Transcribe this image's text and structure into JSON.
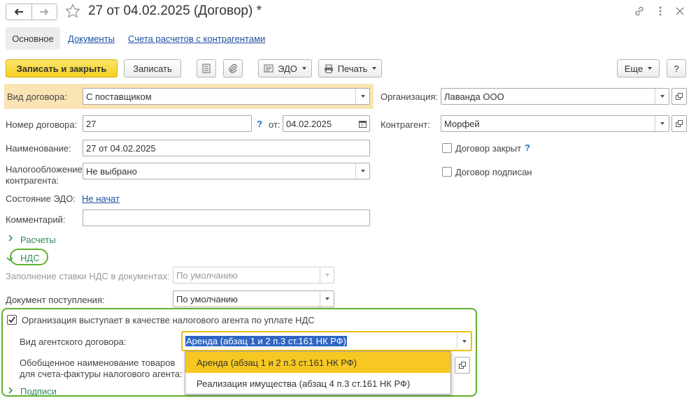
{
  "window": {
    "title": "27 от 04.02.2025 (Договор) *"
  },
  "tabs": [
    {
      "label": "Основное",
      "active": true
    },
    {
      "label": "Документы"
    },
    {
      "label": "Счета расчетов с контрагентами"
    }
  ],
  "toolbar": {
    "save_close": "Записать и закрыть",
    "save": "Записать",
    "edo": "ЭДО",
    "print": "Печать",
    "more": "Еще",
    "help": "?"
  },
  "form": {
    "vid": {
      "label": "Вид договора:",
      "value": "С поставщиком"
    },
    "nomer": {
      "label": "Номер договора:",
      "value": "27",
      "help": "?",
      "date_label": "от:",
      "date": "04.02.2025"
    },
    "naim": {
      "label": "Наименование:",
      "value": "27 от 04.02.2025"
    },
    "nalog": {
      "label_line1": "Налогообложение",
      "label_line2": "контрагента:",
      "value": "Не выбрано"
    },
    "edo_state": {
      "label": "Состояние ЭДО:",
      "value": "Не начат"
    },
    "comment": {
      "label": "Комментарий:",
      "value": ""
    },
    "org": {
      "label": "Организация:",
      "value": "Лаванда ООО"
    },
    "kontr": {
      "label": "Контрагент:",
      "value": "Морфей"
    },
    "closed": {
      "label": "Договор закрыт",
      "help": "?",
      "checked": false
    },
    "signed": {
      "label": "Договор подписан",
      "checked": false
    }
  },
  "groups": {
    "raschety": "Расчеты",
    "nds": "НДС",
    "podpisi": "Подписи"
  },
  "nds": {
    "stavka": {
      "label": "Заполнение ставки НДС в документах:",
      "value": "По умолчанию"
    },
    "doc": {
      "label": "Документ поступления:",
      "value": "По умолчанию"
    },
    "agent": {
      "label": "Организация выступает в качестве налогового агента по уплате НДС",
      "checked": true
    },
    "agent_type": {
      "label": "Вид агентского договора:",
      "value": "Аренда (абзац 1 и 2 п.3 ст.161 НК РФ)"
    },
    "goods": {
      "label_line1": "Обобщенное наименование товаров",
      "label_line2": "для счета-фактуры налогового агента:"
    }
  },
  "dropdown": {
    "options": [
      {
        "label": "Аренда (абзац 1 и 2 п.3 ст.161 НК РФ)",
        "selected": true
      },
      {
        "label": "Реализация имущества (абзац 4 п.3 ст.161 НК РФ)",
        "selected": false
      }
    ]
  },
  "colors": {
    "primary_button": "#f5cf1f",
    "highlight_row": "#fbe4b4",
    "annotation_green": "#5cb22c",
    "link": "#1c4fa3",
    "group_title": "#2e8b57",
    "selection": "#2f65c4"
  }
}
